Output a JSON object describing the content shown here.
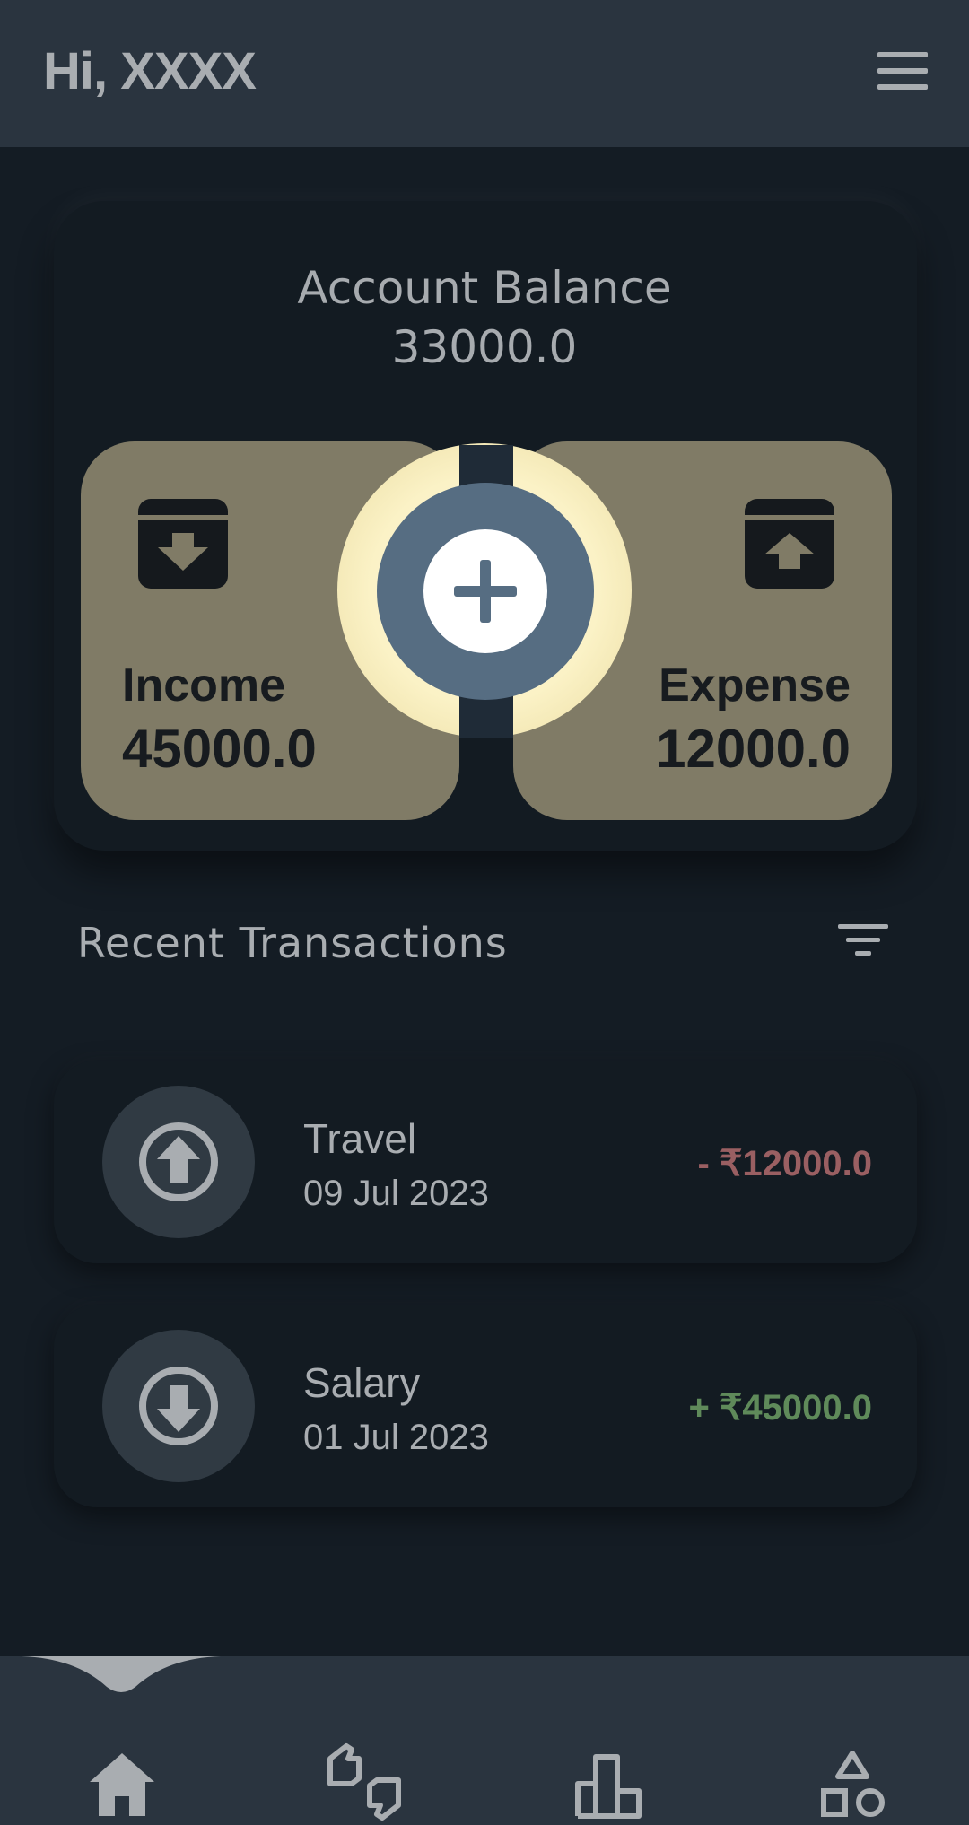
{
  "header": {
    "greeting": "Hi, XXXX",
    "menu_icon": "hamburger-menu-icon"
  },
  "balance": {
    "label": "Account Balance",
    "value": "33000.0"
  },
  "income": {
    "label": "Income",
    "value": "45000.0",
    "icon": "archive-down-icon"
  },
  "expense": {
    "label": "Expense",
    "value": "12000.0",
    "icon": "archive-up-icon"
  },
  "fab": {
    "icon": "plus-icon"
  },
  "recent": {
    "title": "Recent Transactions",
    "filter_icon": "filter-icon"
  },
  "transactions": [
    {
      "title": "Travel",
      "date": "09 Jul 2023",
      "amount": "- ₹12000.0",
      "type": "expense",
      "icon": "arrow-up-circle-icon"
    },
    {
      "title": "Salary",
      "date": "01 Jul 2023",
      "amount": "+ ₹45000.0",
      "type": "income",
      "icon": "arrow-down-circle-icon"
    }
  ],
  "nav": {
    "items": [
      "home-icon",
      "thumbs-up-down-icon",
      "bar-chart-icon",
      "shapes-icon"
    ]
  },
  "colors": {
    "background": "#141c24",
    "header": "#2a343f",
    "card": "#131b22",
    "stat_card": "#807b66",
    "fab_outer": "#566d82",
    "fab_ring": "#fbf2c6",
    "expense_amount": "#9a5f62",
    "income_amount": "#5f8a5a",
    "text_muted": "#a9adb1"
  }
}
